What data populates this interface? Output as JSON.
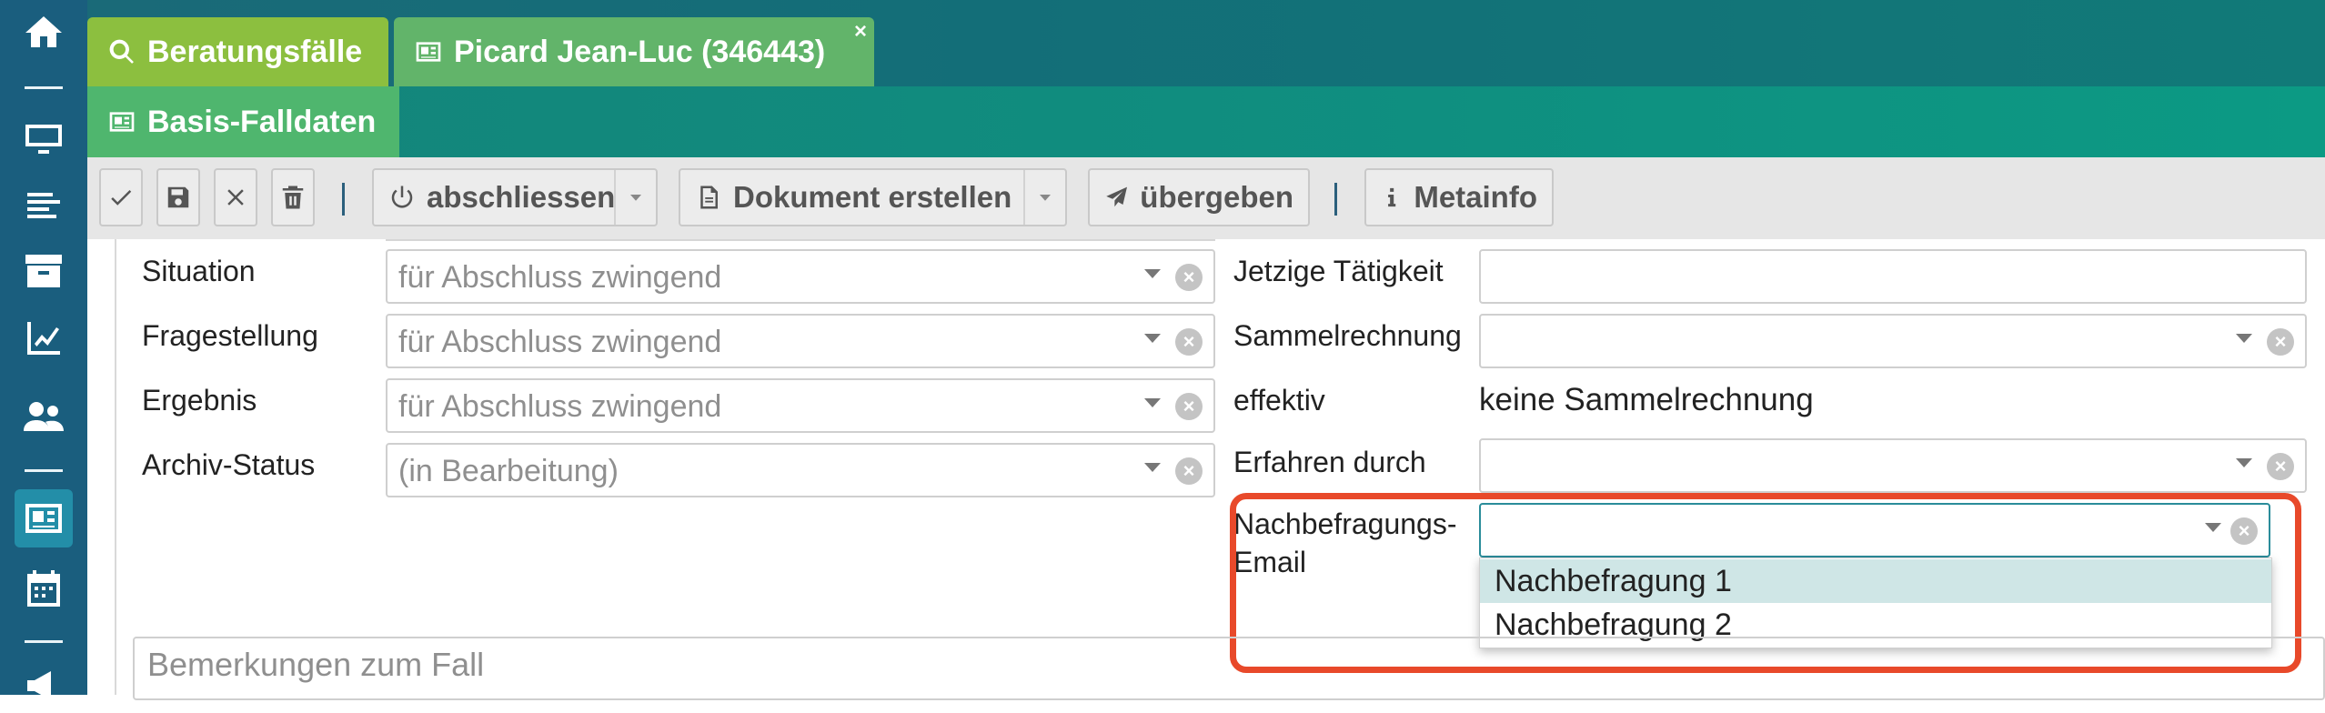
{
  "tabs": {
    "search_label": "Beratungsfälle",
    "person_label": "Picard Jean-Luc (346443)",
    "person_close": "×",
    "basis_label": "Basis-Falldaten"
  },
  "toolbar": {
    "close_case_label": "abschliessen",
    "create_document_label": "Dokument erstellen",
    "hand_over_label": "übergeben",
    "metainfo_label": "Metainfo"
  },
  "form_left": {
    "situation": {
      "label": "Situation",
      "placeholder": "für Abschluss zwingend"
    },
    "question": {
      "label": "Fragestellung",
      "placeholder": "für Abschluss zwingend"
    },
    "result": {
      "label": "Ergebnis",
      "placeholder": "für Abschluss zwingend"
    },
    "archive_status": {
      "label": "Archiv-Status",
      "value": "(in Bearbeitung)"
    }
  },
  "form_right": {
    "current_activity": {
      "label": "Jetzige Tätigkeit",
      "value": ""
    },
    "collective_invoice": {
      "label": "Sammelrechnung",
      "value": ""
    },
    "effective": {
      "label": "effektiv",
      "value": "keine Sammelrechnung"
    },
    "learned_through": {
      "label": "Erfahren durch",
      "value": ""
    },
    "followup_email": {
      "label_line1": "Nachbefragungs-",
      "label_line2": "Email",
      "value": "",
      "options": [
        "Nachbefragung 1",
        "Nachbefragung 2"
      ],
      "highlighted_option": 0
    }
  },
  "remarks": {
    "placeholder": "Bemerkungen zum Fall"
  },
  "colors": {
    "rail": "#1a5e7e",
    "tab_search": "#8cbf3f",
    "tab_person": "#62b46a",
    "tab_basis": "#4fb66e",
    "annotation": "#e8492a"
  }
}
